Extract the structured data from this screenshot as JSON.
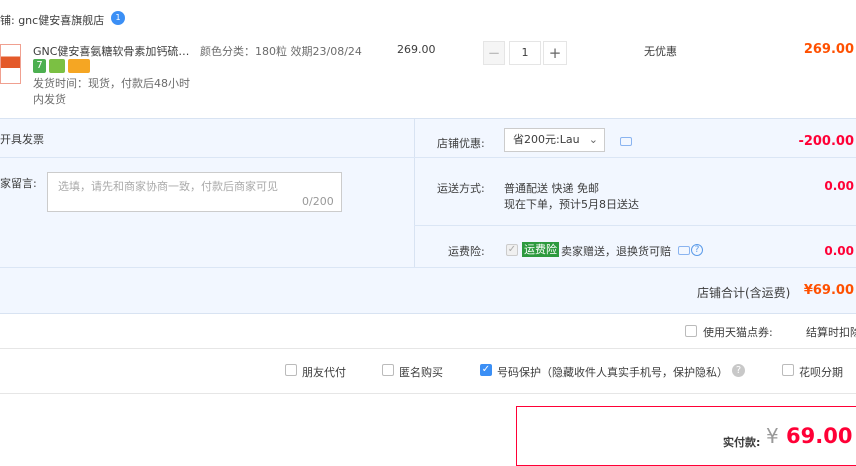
{
  "store": {
    "name": "铺: gnc健安喜旗舰店",
    "badge": "1"
  },
  "item": {
    "name": "GNC健安喜氨糖软骨素加钙硫…",
    "sku": "颜色分类：180粒 效期23/08/24",
    "price": "269.00",
    "quantity": "1",
    "minus_label": "−",
    "plus_label": "+",
    "discount": "无优惠",
    "subtotal": "269.00",
    "delivery": "发货时间：现货，付款后48小时内发货"
  },
  "invoice": {
    "label": "开具发票"
  },
  "message": {
    "label": "家留言:",
    "placeholder": "选填，请先和商家协商一致，付款后商家可见",
    "count": "0/200"
  },
  "coupon": {
    "label": "店铺优惠:",
    "selected": "省200元:Lau",
    "amount": "-200.00"
  },
  "shipping": {
    "label": "运送方式:",
    "method": "普通配送 快递 免邮",
    "eta": "现在下单，预计5月8日送达",
    "amount": "0.00"
  },
  "insurance": {
    "label": "运费险:",
    "tag": "运费险",
    "text": "卖家赠送，退换货可赔",
    "amount": "0.00",
    "help": "?"
  },
  "total": {
    "label": "店铺合计(含运费)",
    "amount": "¥69.00"
  },
  "coupon_row": {
    "tmall_label": "使用天猫点券:",
    "settle_label": "结算时扣除"
  },
  "options": {
    "friend_pay": "朋友代付",
    "anonymous": "匿名购买",
    "number_protect": "号码保护（隐藏收件人真实手机号，保护隐私）",
    "installment": "花呗分期",
    "help": "?"
  },
  "payment": {
    "label": "实付款:",
    "currency": "¥",
    "amount": "69.00"
  },
  "colors": {
    "accent": "#ff0036",
    "orange": "#ff5000",
    "blue": "#3b8ff5",
    "panel": "#f2f7ff"
  }
}
